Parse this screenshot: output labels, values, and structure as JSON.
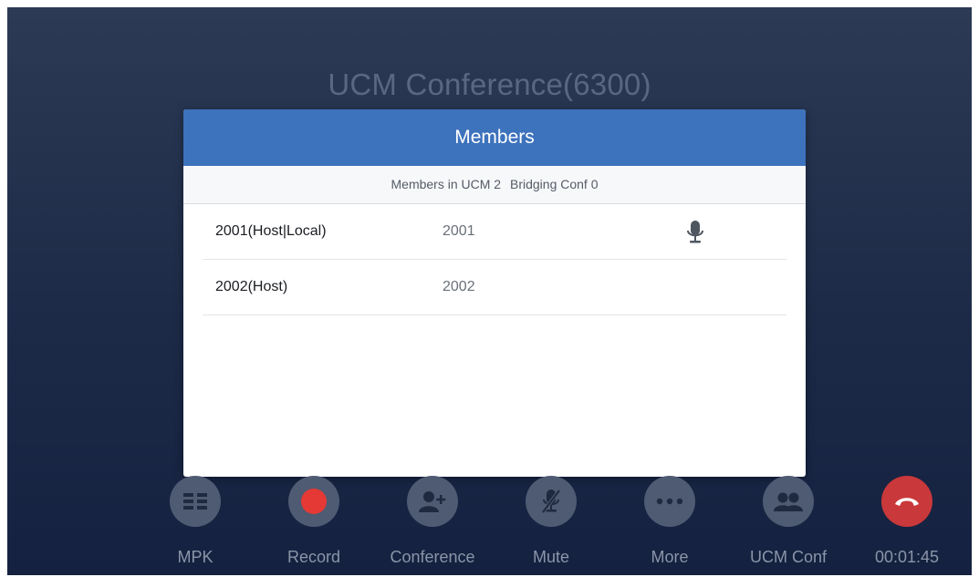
{
  "call": {
    "title": "UCM Conference(6300)"
  },
  "dialog": {
    "title": "Members",
    "members_in_ucm_label": "Members in UCM 2",
    "bridging_conf_label": "Bridging Conf 0",
    "members": [
      {
        "name": "2001(Host|Local)",
        "number": "2001",
        "icon": "microphone-icon"
      },
      {
        "name": "2002(Host)",
        "number": "2002",
        "icon": ""
      }
    ]
  },
  "actions": [
    {
      "label": "MPK",
      "icon": "mpk-grid-icon"
    },
    {
      "label": "Record",
      "icon": "record-dot-icon",
      "accent": "#e53935"
    },
    {
      "label": "Conference",
      "icon": "add-person-icon"
    },
    {
      "label": "Mute",
      "icon": "microphone-muted-icon"
    },
    {
      "label": "More",
      "icon": "more-dots-icon"
    },
    {
      "label": "UCM Conf",
      "icon": "group-icon"
    },
    {
      "label": "00:01:45",
      "icon": "hangup-icon",
      "accent": "#c9383a"
    }
  ],
  "colors": {
    "header_blue": "#3d72bd",
    "button_gray": "#4f5b72",
    "hangup_red": "#c9383a",
    "record_red": "#e53935"
  }
}
